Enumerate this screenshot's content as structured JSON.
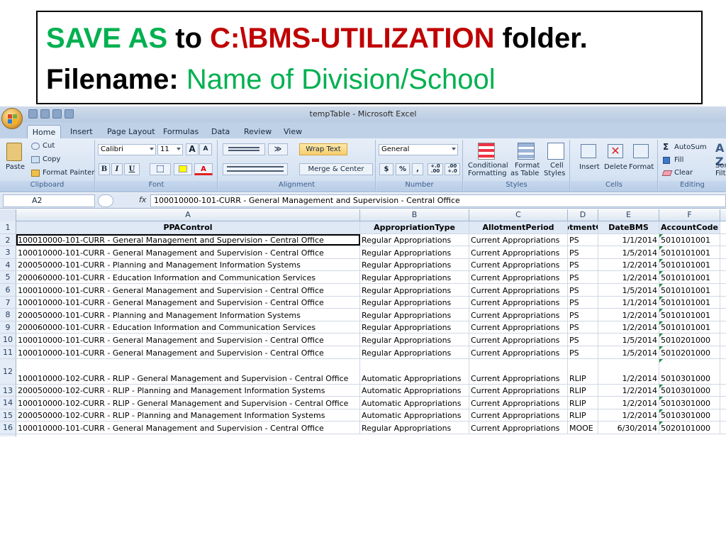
{
  "instruction": {
    "line1": [
      {
        "text": "SAVE AS",
        "color": "green"
      },
      {
        "text": " to ",
        "color": "black"
      },
      {
        "text": "C:\\BMS-UTILIZATION",
        "color": "red"
      },
      {
        "text": " folder.",
        "color": "black"
      }
    ],
    "line2": [
      {
        "text": "Filename: ",
        "color": "black"
      },
      {
        "text": "Name of Division/School",
        "color": "green"
      }
    ]
  },
  "window": {
    "title": "tempTable - Microsoft Excel"
  },
  "tabs": [
    "Home",
    "Insert",
    "Page Layout",
    "Formulas",
    "Data",
    "Review",
    "View"
  ],
  "ribbon": {
    "clipboard": {
      "paste": "Paste",
      "cut": "Cut",
      "copy": "Copy",
      "format_painter": "Format Painter",
      "label": "Clipboard"
    },
    "font": {
      "name": "Calibri",
      "size": "11",
      "label": "Font",
      "bold": "B",
      "italic": "I",
      "underline": "U",
      "grow": "A",
      "shrink": "A",
      "font_color": "A"
    },
    "alignment": {
      "wrap_text": "Wrap Text",
      "merge_center": "Merge & Center",
      "label": "Alignment"
    },
    "number": {
      "format": "General",
      "currency": "$",
      "percent": "%",
      "comma": ",",
      "inc_decimal": "+.0 .00",
      "dec_decimal": ".00 +.0",
      "label": "Number"
    },
    "styles": {
      "conditional": "Conditional",
      "conditional2": "Formatting",
      "format_as": "Format",
      "format_as2": "as Table",
      "cell": "Cell",
      "cell2": "Styles",
      "label": "Styles"
    },
    "cells": {
      "insert": "Insert",
      "delete": "Delete",
      "format": "Format",
      "label": "Cells"
    },
    "editing": {
      "autosum": "AutoSum",
      "fill": "Fill",
      "clear": "Clear",
      "sort": "Sor",
      "sort2": "Filte",
      "label": "Editing"
    }
  },
  "formula_bar": {
    "name_box": "A2",
    "fx": "fx",
    "formula": "100010000-101-CURR - General Management and Supervision - Central Office"
  },
  "grid": {
    "columns": [
      "A",
      "B",
      "C",
      "D",
      "E",
      "F"
    ],
    "headers": [
      "PPAControl",
      "AppropriationType",
      "AllotmentPeriod",
      "otmentC",
      "DateBMS",
      "AccountCode"
    ],
    "rows": [
      {
        "n": "2",
        "a": "100010000-101-CURR - General Management and Supervision - Central Office",
        "b": "Regular Appropriations",
        "c": "Current Appropriations",
        "d": "PS",
        "e": "1/1/2014",
        "f": "5010101001"
      },
      {
        "n": "3",
        "a": "100010000-101-CURR - General Management and Supervision - Central Office",
        "b": "Regular Appropriations",
        "c": "Current Appropriations",
        "d": "PS",
        "e": "1/5/2014",
        "f": "5010101001"
      },
      {
        "n": "4",
        "a": "200050000-101-CURR - Planning and Management Information Systems",
        "b": "Regular Appropriations",
        "c": "Current Appropriations",
        "d": "PS",
        "e": "1/2/2014",
        "f": "5010101001"
      },
      {
        "n": "5",
        "a": "200060000-101-CURR - Education Information and Communication Services",
        "b": "Regular Appropriations",
        "c": "Current Appropriations",
        "d": "PS",
        "e": "1/2/2014",
        "f": "5010101001"
      },
      {
        "n": "6",
        "a": "100010000-101-CURR - General Management and Supervision - Central Office",
        "b": "Regular Appropriations",
        "c": "Current Appropriations",
        "d": "PS",
        "e": "1/5/2014",
        "f": "5010101001"
      },
      {
        "n": "7",
        "a": "100010000-101-CURR - General Management and Supervision - Central Office",
        "b": "Regular Appropriations",
        "c": "Current Appropriations",
        "d": "PS",
        "e": "1/1/2014",
        "f": "5010101001"
      },
      {
        "n": "8",
        "a": "200050000-101-CURR - Planning and Management Information Systems",
        "b": "Regular Appropriations",
        "c": "Current Appropriations",
        "d": "PS",
        "e": "1/2/2014",
        "f": "5010101001"
      },
      {
        "n": "9",
        "a": "200060000-101-CURR - Education Information and Communication Services",
        "b": "Regular Appropriations",
        "c": "Current Appropriations",
        "d": "PS",
        "e": "1/2/2014",
        "f": "5010101001"
      },
      {
        "n": "10",
        "a": "100010000-101-CURR - General Management and Supervision - Central Office",
        "b": "Regular Appropriations",
        "c": "Current Appropriations",
        "d": "PS",
        "e": "1/5/2014",
        "f": "5010201000"
      },
      {
        "n": "11",
        "a": "100010000-101-CURR - General Management and Supervision - Central Office",
        "b": "Regular Appropriations",
        "c": "Current Appropriations",
        "d": "PS",
        "e": "1/5/2014",
        "f": "5010201000"
      },
      {
        "n": "12",
        "a": "100010000-102-CURR - RLIP - General Management and Supervision - Central Office",
        "b": "Automatic Appropriations",
        "c": "Current Appropriations",
        "d": "RLIP",
        "e": "1/2/2014",
        "f": "5010301000",
        "tall": true
      },
      {
        "n": "13",
        "a": "200050000-102-CURR - RLIP - Planning and Management Information Systems",
        "b": "Automatic Appropriations",
        "c": "Current Appropriations",
        "d": "RLIP",
        "e": "1/2/2014",
        "f": "5010301000"
      },
      {
        "n": "14",
        "a": "100010000-102-CURR - RLIP - General Management and Supervision - Central Office",
        "b": "Automatic Appropriations",
        "c": "Current Appropriations",
        "d": "RLIP",
        "e": "1/2/2014",
        "f": "5010301000"
      },
      {
        "n": "15",
        "a": "200050000-102-CURR - RLIP - Planning and Management Information Systems",
        "b": "Automatic Appropriations",
        "c": "Current Appropriations",
        "d": "RLIP",
        "e": "1/2/2014",
        "f": "5010301000"
      },
      {
        "n": "16",
        "a": "100010000-101-CURR - General Management and Supervision - Central Office",
        "b": "Regular Appropriations",
        "c": "Current Appropriations",
        "d": "MOOE",
        "e": "6/30/2014",
        "f": "5020101000"
      }
    ]
  },
  "colors": {
    "green": "#00b050",
    "red": "#c00000",
    "header_fill": "#dfe8f5"
  }
}
